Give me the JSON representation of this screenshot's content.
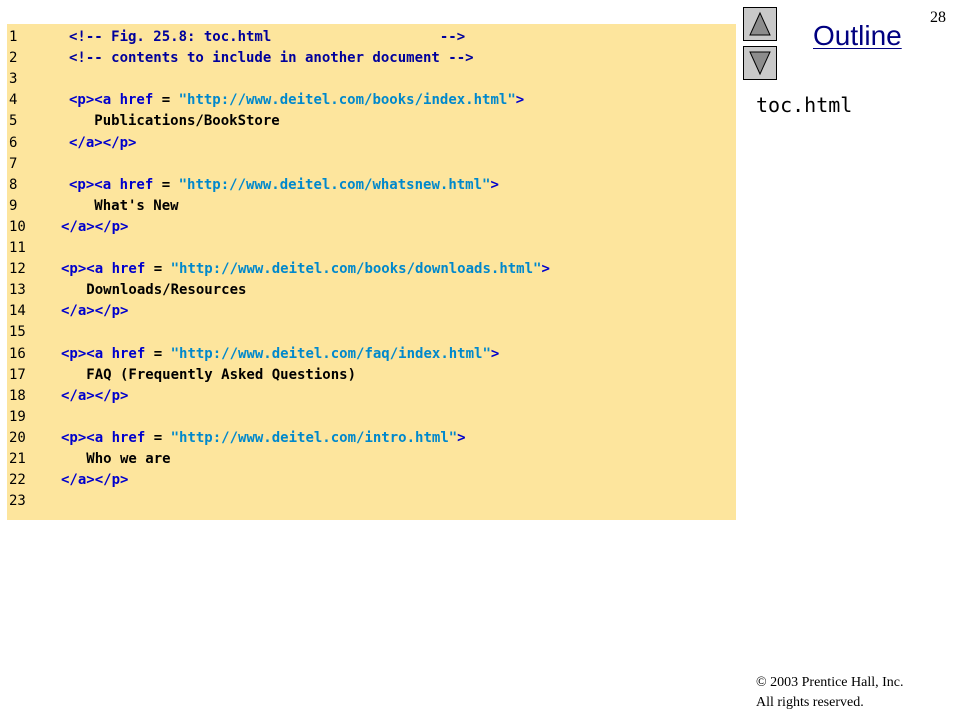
{
  "slide": {
    "page_number": "28",
    "outline_label": "Outline",
    "file_name": "toc.html",
    "copyright_line1": "© 2003 Prentice Hall, Inc.",
    "copyright_line2": "All rights reserved."
  },
  "nav": {
    "up_icon": "up-arrow-icon",
    "down_icon": "down-arrow-icon"
  },
  "colors": {
    "code_background": "#fde59d",
    "outline_title": "#000080"
  },
  "code_lines": [
    {
      "num": "1",
      "segments": [
        {
          "t": "<!-- Fig. 25.8: toc.html                    -->",
          "k": "comment"
        }
      ]
    },
    {
      "num": "2",
      "segments": [
        {
          "t": "<!-- contents to include in another document -->",
          "k": "comment"
        }
      ]
    },
    {
      "num": "3",
      "segments": []
    },
    {
      "num": "4",
      "segments": [
        {
          "t": "<p><a ",
          "k": "tag"
        },
        {
          "t": "href",
          "k": "attr"
        },
        {
          "t": " = ",
          "k": "text"
        },
        {
          "t": "\"http://www.deitel.com/books/index.html\"",
          "k": "string"
        },
        {
          "t": ">",
          "k": "tag"
        }
      ]
    },
    {
      "num": "5",
      "segments": [
        {
          "t": "   Publications/BookStore",
          "k": "text"
        }
      ]
    },
    {
      "num": "6",
      "segments": [
        {
          "t": "</a></p>",
          "k": "tag"
        }
      ]
    },
    {
      "num": "7",
      "segments": []
    },
    {
      "num": "8",
      "segments": [
        {
          "t": "<p><a ",
          "k": "tag"
        },
        {
          "t": "href",
          "k": "attr"
        },
        {
          "t": " = ",
          "k": "text"
        },
        {
          "t": "\"http://www.deitel.com/whatsnew.html\"",
          "k": "string"
        },
        {
          "t": ">",
          "k": "tag"
        }
      ]
    },
    {
      "num": "9",
      "segments": [
        {
          "t": "   What's New",
          "k": "text"
        }
      ]
    },
    {
      "num": "10",
      "segments": [
        {
          "t": "</a></p>",
          "k": "tag"
        }
      ]
    },
    {
      "num": "11",
      "segments": []
    },
    {
      "num": "12",
      "segments": [
        {
          "t": "<p><a ",
          "k": "tag"
        },
        {
          "t": "href",
          "k": "attr"
        },
        {
          "t": " = ",
          "k": "text"
        },
        {
          "t": "\"http://www.deitel.com/books/downloads.html\"",
          "k": "string"
        },
        {
          "t": ">",
          "k": "tag"
        }
      ]
    },
    {
      "num": "13",
      "segments": [
        {
          "t": "   Downloads/Resources",
          "k": "text"
        }
      ]
    },
    {
      "num": "14",
      "segments": [
        {
          "t": "</a></p>",
          "k": "tag"
        }
      ]
    },
    {
      "num": "15",
      "segments": []
    },
    {
      "num": "16",
      "segments": [
        {
          "t": "<p><a ",
          "k": "tag"
        },
        {
          "t": "href",
          "k": "attr"
        },
        {
          "t": " = ",
          "k": "text"
        },
        {
          "t": "\"http://www.deitel.com/faq/index.html\"",
          "k": "string"
        },
        {
          "t": ">",
          "k": "tag"
        }
      ]
    },
    {
      "num": "17",
      "segments": [
        {
          "t": "   FAQ (Frequently Asked Questions)",
          "k": "text"
        }
      ]
    },
    {
      "num": "18",
      "segments": [
        {
          "t": "</a></p>",
          "k": "tag"
        }
      ]
    },
    {
      "num": "19",
      "segments": []
    },
    {
      "num": "20",
      "segments": [
        {
          "t": "<p><a ",
          "k": "tag"
        },
        {
          "t": "href",
          "k": "attr"
        },
        {
          "t": " = ",
          "k": "text"
        },
        {
          "t": "\"http://www.deitel.com/intro.html\"",
          "k": "string"
        },
        {
          "t": ">",
          "k": "tag"
        }
      ]
    },
    {
      "num": "21",
      "segments": [
        {
          "t": "   Who we are",
          "k": "text"
        }
      ]
    },
    {
      "num": "22",
      "segments": [
        {
          "t": "</a></p>",
          "k": "tag"
        }
      ]
    },
    {
      "num": "23",
      "segments": []
    }
  ]
}
